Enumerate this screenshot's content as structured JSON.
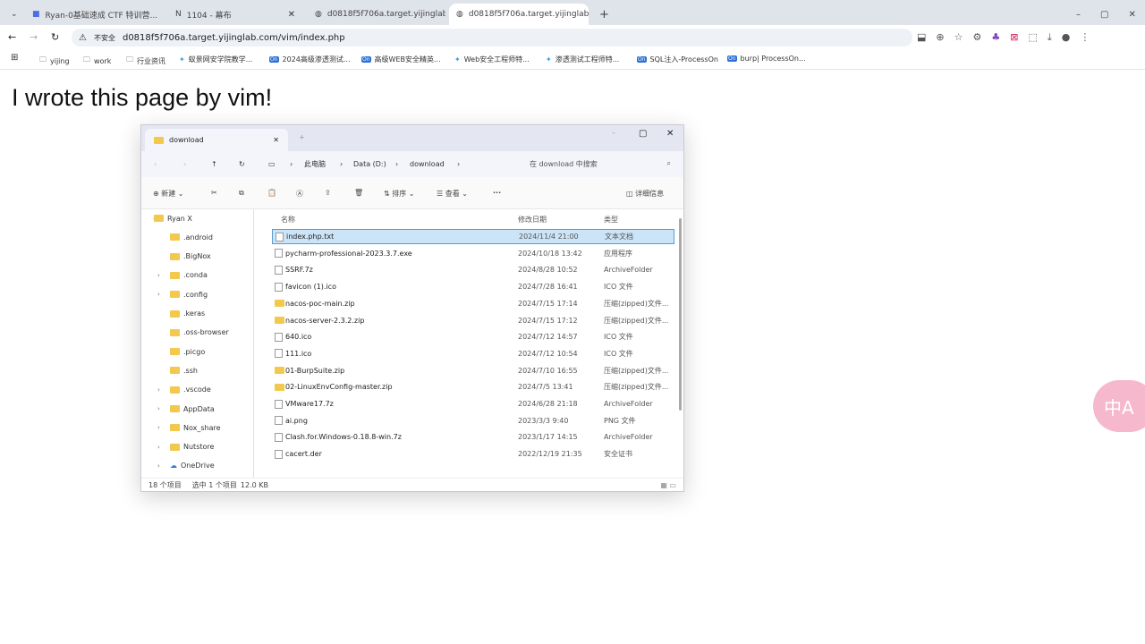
{
  "browser": {
    "tabs": [
      {
        "title": "Ryan-0基础速成 CTF 特训营...",
        "active": false
      },
      {
        "title": "1104 - 幕布",
        "active": false
      },
      {
        "title": "d0818f5f706a.target.yijinglab...",
        "active": false
      },
      {
        "title": "d0818f5f706a.target.yijinglab...",
        "active": true
      }
    ],
    "security_label": "不安全",
    "url": "d0818f5f706a.target.yijinglab.com/vim/index.php",
    "bookmarks": [
      "yijing",
      "work",
      "行业资讯",
      "蚁景网安学院教学...",
      "2024高级渗透测试...",
      "高级WEB安全精英...",
      "Web安全工程师特...",
      "渗透测试工程师特...",
      "SQL注入-ProcessOn",
      "burp| ProcessOn..."
    ]
  },
  "page": {
    "heading": "I wrote this page by vim!"
  },
  "explorer": {
    "tab_title": "download",
    "breadcrumb": [
      "此电脑",
      "Data (D:)",
      "download"
    ],
    "search_placeholder": "在 download 中搜索",
    "toolbar": {
      "new": "新建",
      "sort": "排序",
      "view": "查看",
      "more": "···",
      "details": "详细信息"
    },
    "sidebar": [
      {
        "label": "Ryan X",
        "expanded": true
      },
      {
        "label": ".android"
      },
      {
        "label": ".BigNox"
      },
      {
        "label": ".conda",
        "chev": true
      },
      {
        "label": ".config",
        "chev": true
      },
      {
        "label": ".keras"
      },
      {
        "label": ".oss-browser"
      },
      {
        "label": ".picgo"
      },
      {
        "label": ".ssh"
      },
      {
        "label": ".vscode",
        "chev": true
      },
      {
        "label": "AppData",
        "chev": true
      },
      {
        "label": "Nox_share",
        "chev": true
      },
      {
        "label": "Nutstore",
        "chev": true
      },
      {
        "label": "OneDrive",
        "chev": true
      }
    ],
    "columns": {
      "name": "名称",
      "date": "修改日期",
      "type": "类型"
    },
    "files": [
      {
        "name": "index.php.txt",
        "date": "2024/11/4 21:00",
        "type": "文本文档",
        "selected": true
      },
      {
        "name": "pycharm-professional-2023.3.7.exe",
        "date": "2024/10/18 13:42",
        "type": "应用程序"
      },
      {
        "name": "SSRF.7z",
        "date": "2024/8/28 10:52",
        "type": "ArchiveFolder"
      },
      {
        "name": "favicon (1).ico",
        "date": "2024/7/28 16:41",
        "type": "ICO 文件"
      },
      {
        "name": "nacos-poc-main.zip",
        "date": "2024/7/15 17:14",
        "type": "压缩(zipped)文件..."
      },
      {
        "name": "nacos-server-2.3.2.zip",
        "date": "2024/7/15 17:12",
        "type": "压缩(zipped)文件..."
      },
      {
        "name": "640.ico",
        "date": "2024/7/12 14:57",
        "type": "ICO 文件"
      },
      {
        "name": "111.ico",
        "date": "2024/7/12 10:54",
        "type": "ICO 文件"
      },
      {
        "name": "01-BurpSuite.zip",
        "date": "2024/7/10 16:55",
        "type": "压缩(zipped)文件..."
      },
      {
        "name": "02-LinuxEnvConfig-master.zip",
        "date": "2024/7/5 13:41",
        "type": "压缩(zipped)文件..."
      },
      {
        "name": "VMware17.7z",
        "date": "2024/6/28 21:18",
        "type": "ArchiveFolder"
      },
      {
        "name": "ai.png",
        "date": "2023/3/3 9:40",
        "type": "PNG 文件"
      },
      {
        "name": "Clash.for.Windows-0.18.8-win.7z",
        "date": "2023/1/17 14:15",
        "type": "ArchiveFolder"
      },
      {
        "name": "cacert.der",
        "date": "2022/12/19 21:35",
        "type": "安全证书"
      }
    ],
    "status": {
      "count": "18 个项目",
      "selected": "选中 1 个项目",
      "size": "12.0 KB"
    }
  },
  "translate_button": "中A"
}
